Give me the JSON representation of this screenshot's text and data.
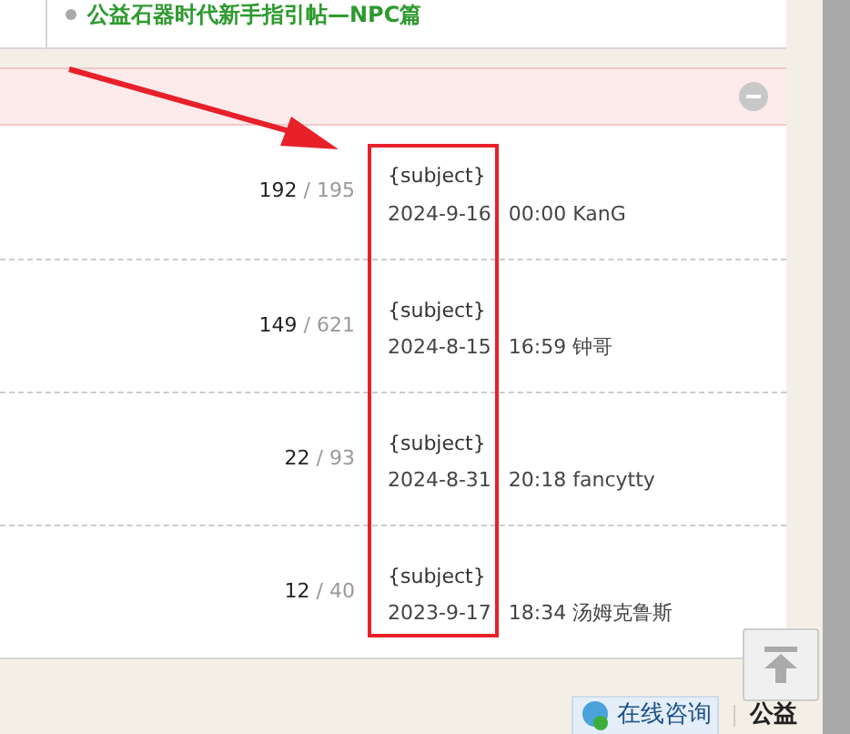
{
  "guide_link": {
    "text": "公益石器时代新手指引帖—NPC篇"
  },
  "section": {
    "collapsed": false
  },
  "threads": [
    {
      "replies": "192",
      "sep": "/",
      "views": "195",
      "subject": "{subject}",
      "date": "2024-9-16 00:00",
      "author": "KanG"
    },
    {
      "replies": "149",
      "sep": "/",
      "views": "621",
      "subject": "{subject}",
      "date": "2024-8-15 16:59",
      "author": "钟哥"
    },
    {
      "replies": "22",
      "sep": "/",
      "views": "93",
      "subject": "{subject}",
      "date": "2024-8-31 20:18",
      "author": "fancytty"
    },
    {
      "replies": "12",
      "sep": "/",
      "views": "40",
      "subject": "{subject}",
      "date": "2023-9-17 18:34",
      "author": "汤姆克鲁斯"
    }
  ],
  "footer": {
    "consult": "在线咨询",
    "brand": "公益"
  }
}
